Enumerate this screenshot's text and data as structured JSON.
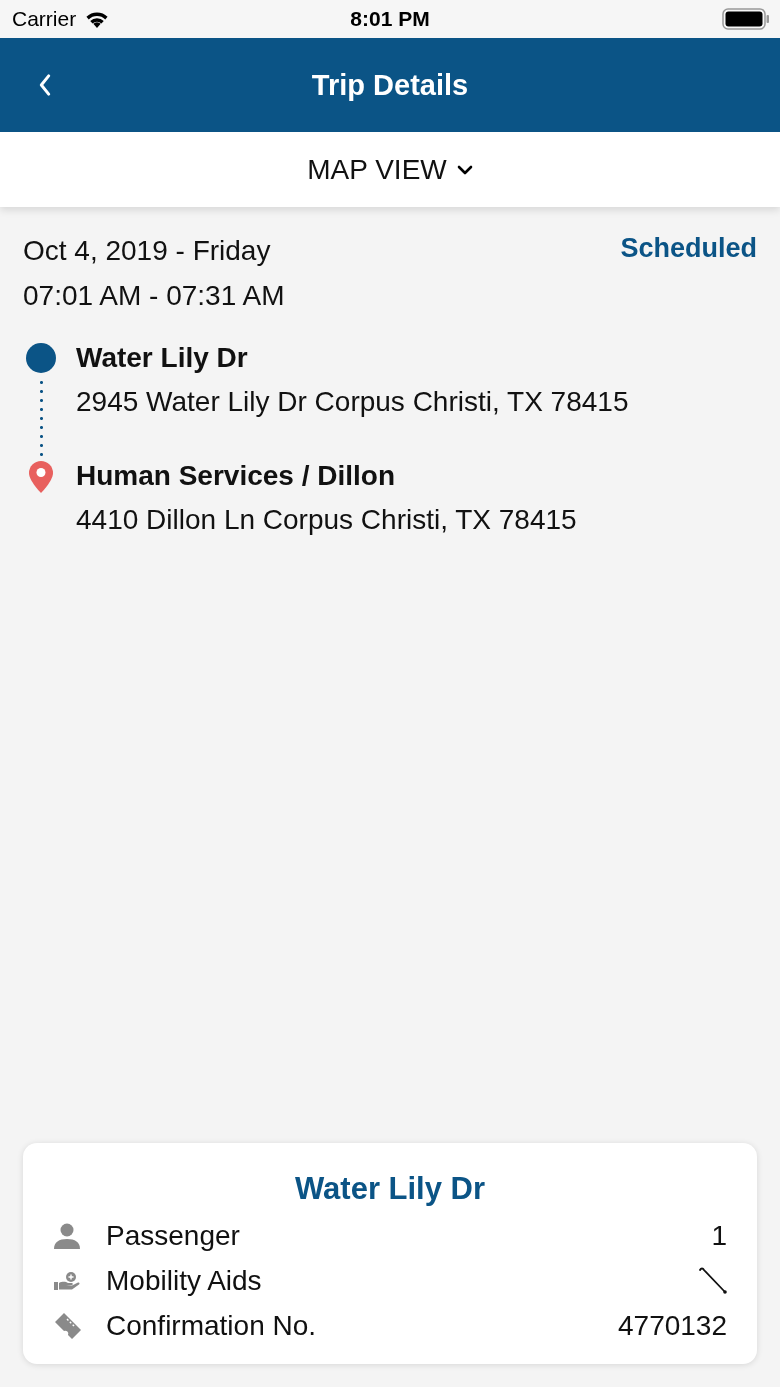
{
  "status_bar": {
    "carrier": "Carrier",
    "time": "8:01 PM"
  },
  "header": {
    "title": "Trip Details"
  },
  "view_selector": {
    "label": "MAP VIEW"
  },
  "trip": {
    "date": "Oct 4, 2019 - Friday",
    "time_window": "07:01 AM - 07:31 AM",
    "status": "Scheduled"
  },
  "stops": [
    {
      "kind": "origin",
      "name": "Water Lily Dr",
      "address": "2945 Water Lily Dr Corpus Christi, TX 78415"
    },
    {
      "kind": "destination",
      "name": "Human Services / Dillon",
      "address": "4410 Dillon Ln Corpus Christi, TX 78415"
    }
  ],
  "details_card": {
    "title": "Water Lily Dr",
    "rows": [
      {
        "kind": "text",
        "label": "Passenger",
        "value": "1"
      },
      {
        "kind": "icon",
        "label": "Mobility Aids"
      },
      {
        "kind": "text",
        "label": "Confirmation No.",
        "value": "4770132"
      }
    ]
  }
}
